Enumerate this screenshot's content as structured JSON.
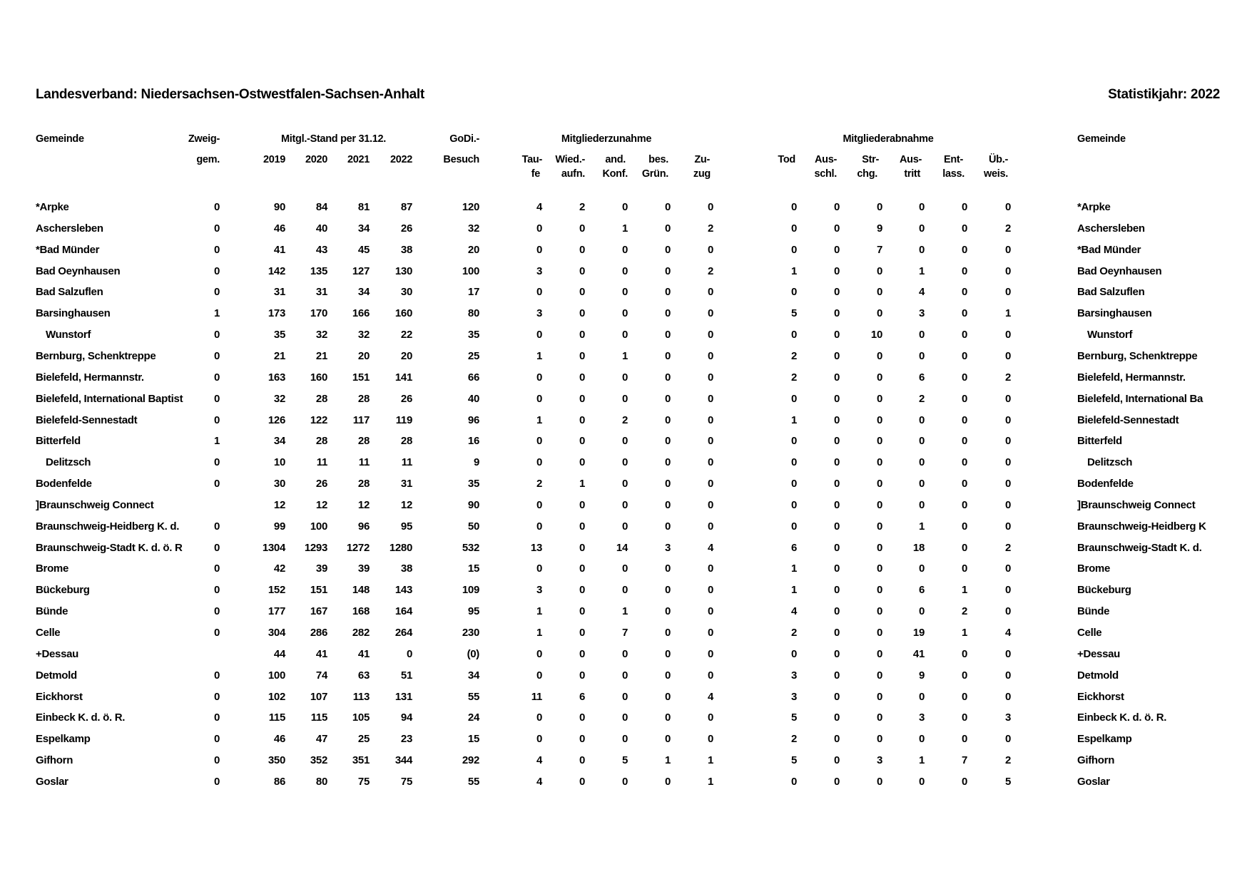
{
  "header": {
    "title_left": "Landesverband: Niedersachsen-Ostwestfalen-Sachsen-Anhalt",
    "title_right": "Statistikjahr: 2022"
  },
  "columns": {
    "gemeinde": "Gemeinde",
    "zweig_1": "Zweig-",
    "zweig_2": "gem.",
    "mitgl_group": "Mitgl.-Stand per 31.12.",
    "y2019": "2019",
    "y2020": "2020",
    "y2021": "2021",
    "y2022": "2022",
    "godi_1": "GoDi.-",
    "godi_2": "Besuch",
    "zunahme_group": "Mitgliederzunahme",
    "taufe_1": "Tau-",
    "taufe_2": "fe",
    "wied_1": "Wied.-",
    "wied_2": "aufn.",
    "and_1": "and.",
    "and_2": "Konf.",
    "bes_1": "bes.",
    "bes_2": "Grün.",
    "zuzug_1": "Zu-",
    "zuzug_2": "zug",
    "abnahme_group": "Mitgliederabnahme",
    "tod": "Tod",
    "aus_1": "Aus-",
    "aus_2": "schl.",
    "str_1": "Str-",
    "str_2": "chg.",
    "austritt_1": "Aus-",
    "austritt_2": "tritt",
    "ent_1": "Ent-",
    "ent_2": "lass.",
    "ub_1": "Üb.-",
    "ub_2": "weis.",
    "gemeinde_right": "Gemeinde"
  },
  "rows": [
    {
      "name": "*Arpke",
      "name_right": "*Arpke",
      "indent": false,
      "zweig": "0",
      "y2019": "90",
      "y2020": "84",
      "y2021": "81",
      "y2022": "87",
      "godi": "120",
      "taufe": "4",
      "wied": "2",
      "andkonf": "0",
      "bes": "0",
      "zuzug": "0",
      "tod": "0",
      "ausschl": "0",
      "strchg": "0",
      "austritt": "0",
      "entlass": "0",
      "ubweis": "0"
    },
    {
      "name": "Aschersleben",
      "name_right": "Aschersleben",
      "indent": false,
      "zweig": "0",
      "y2019": "46",
      "y2020": "40",
      "y2021": "34",
      "y2022": "26",
      "godi": "32",
      "taufe": "0",
      "wied": "0",
      "andkonf": "1",
      "bes": "0",
      "zuzug": "2",
      "tod": "0",
      "ausschl": "0",
      "strchg": "9",
      "austritt": "0",
      "entlass": "0",
      "ubweis": "2"
    },
    {
      "name": "*Bad Münder",
      "name_right": "*Bad Münder",
      "indent": false,
      "zweig": "0",
      "y2019": "41",
      "y2020": "43",
      "y2021": "45",
      "y2022": "38",
      "godi": "20",
      "taufe": "0",
      "wied": "0",
      "andkonf": "0",
      "bes": "0",
      "zuzug": "0",
      "tod": "0",
      "ausschl": "0",
      "strchg": "7",
      "austritt": "0",
      "entlass": "0",
      "ubweis": "0"
    },
    {
      "name": "Bad Oeynhausen",
      "name_right": "Bad Oeynhausen",
      "indent": false,
      "zweig": "0",
      "y2019": "142",
      "y2020": "135",
      "y2021": "127",
      "y2022": "130",
      "godi": "100",
      "taufe": "3",
      "wied": "0",
      "andkonf": "0",
      "bes": "0",
      "zuzug": "2",
      "tod": "1",
      "ausschl": "0",
      "strchg": "0",
      "austritt": "1",
      "entlass": "0",
      "ubweis": "0"
    },
    {
      "name": "Bad Salzuflen",
      "name_right": "Bad Salzuflen",
      "indent": false,
      "zweig": "0",
      "y2019": "31",
      "y2020": "31",
      "y2021": "34",
      "y2022": "30",
      "godi": "17",
      "taufe": "0",
      "wied": "0",
      "andkonf": "0",
      "bes": "0",
      "zuzug": "0",
      "tod": "0",
      "ausschl": "0",
      "strchg": "0",
      "austritt": "4",
      "entlass": "0",
      "ubweis": "0"
    },
    {
      "name": "Barsinghausen",
      "name_right": "Barsinghausen",
      "indent": false,
      "zweig": "1",
      "y2019": "173",
      "y2020": "170",
      "y2021": "166",
      "y2022": "160",
      "godi": "80",
      "taufe": "3",
      "wied": "0",
      "andkonf": "0",
      "bes": "0",
      "zuzug": "0",
      "tod": "5",
      "ausschl": "0",
      "strchg": "0",
      "austritt": "3",
      "entlass": "0",
      "ubweis": "1"
    },
    {
      "name": "Wunstorf",
      "name_right": "Wunstorf",
      "indent": true,
      "zweig": "0",
      "y2019": "35",
      "y2020": "32",
      "y2021": "32",
      "y2022": "22",
      "godi": "35",
      "taufe": "0",
      "wied": "0",
      "andkonf": "0",
      "bes": "0",
      "zuzug": "0",
      "tod": "0",
      "ausschl": "0",
      "strchg": "10",
      "austritt": "0",
      "entlass": "0",
      "ubweis": "0"
    },
    {
      "name": "Bernburg, Schenktreppe",
      "name_right": "Bernburg, Schenktreppe",
      "indent": false,
      "zweig": "0",
      "y2019": "21",
      "y2020": "21",
      "y2021": "20",
      "y2022": "20",
      "godi": "25",
      "taufe": "1",
      "wied": "0",
      "andkonf": "1",
      "bes": "0",
      "zuzug": "0",
      "tod": "2",
      "ausschl": "0",
      "strchg": "0",
      "austritt": "0",
      "entlass": "0",
      "ubweis": "0"
    },
    {
      "name": "Bielefeld, Hermannstr.",
      "name_right": "Bielefeld, Hermannstr.",
      "indent": false,
      "zweig": "0",
      "y2019": "163",
      "y2020": "160",
      "y2021": "151",
      "y2022": "141",
      "godi": "66",
      "taufe": "0",
      "wied": "0",
      "andkonf": "0",
      "bes": "0",
      "zuzug": "0",
      "tod": "2",
      "ausschl": "0",
      "strchg": "0",
      "austritt": "6",
      "entlass": "0",
      "ubweis": "2"
    },
    {
      "name": "Bielefeld, International Baptist",
      "name_right": "Bielefeld, International Ba",
      "indent": false,
      "zweig": "0",
      "y2019": "32",
      "y2020": "28",
      "y2021": "28",
      "y2022": "26",
      "godi": "40",
      "taufe": "0",
      "wied": "0",
      "andkonf": "0",
      "bes": "0",
      "zuzug": "0",
      "tod": "0",
      "ausschl": "0",
      "strchg": "0",
      "austritt": "2",
      "entlass": "0",
      "ubweis": "0"
    },
    {
      "name": "Bielefeld-Sennestadt",
      "name_right": "Bielefeld-Sennestadt",
      "indent": false,
      "zweig": "0",
      "y2019": "126",
      "y2020": "122",
      "y2021": "117",
      "y2022": "119",
      "godi": "96",
      "taufe": "1",
      "wied": "0",
      "andkonf": "2",
      "bes": "0",
      "zuzug": "0",
      "tod": "1",
      "ausschl": "0",
      "strchg": "0",
      "austritt": "0",
      "entlass": "0",
      "ubweis": "0"
    },
    {
      "name": "Bitterfeld",
      "name_right": "Bitterfeld",
      "indent": false,
      "zweig": "1",
      "y2019": "34",
      "y2020": "28",
      "y2021": "28",
      "y2022": "28",
      "godi": "16",
      "taufe": "0",
      "wied": "0",
      "andkonf": "0",
      "bes": "0",
      "zuzug": "0",
      "tod": "0",
      "ausschl": "0",
      "strchg": "0",
      "austritt": "0",
      "entlass": "0",
      "ubweis": "0"
    },
    {
      "name": "Delitzsch",
      "name_right": "Delitzsch",
      "indent": true,
      "zweig": "0",
      "y2019": "10",
      "y2020": "11",
      "y2021": "11",
      "y2022": "11",
      "godi": "9",
      "taufe": "0",
      "wied": "0",
      "andkonf": "0",
      "bes": "0",
      "zuzug": "0",
      "tod": "0",
      "ausschl": "0",
      "strchg": "0",
      "austritt": "0",
      "entlass": "0",
      "ubweis": "0"
    },
    {
      "name": "Bodenfelde",
      "name_right": "Bodenfelde",
      "indent": false,
      "zweig": "0",
      "y2019": "30",
      "y2020": "26",
      "y2021": "28",
      "y2022": "31",
      "godi": "35",
      "taufe": "2",
      "wied": "1",
      "andkonf": "0",
      "bes": "0",
      "zuzug": "0",
      "tod": "0",
      "ausschl": "0",
      "strchg": "0",
      "austritt": "0",
      "entlass": "0",
      "ubweis": "0"
    },
    {
      "name": "]Braunschweig Connect",
      "name_right": "]Braunschweig Connect",
      "indent": false,
      "zweig": "",
      "y2019": "12",
      "y2020": "12",
      "y2021": "12",
      "y2022": "12",
      "godi": "90",
      "taufe": "0",
      "wied": "0",
      "andkonf": "0",
      "bes": "0",
      "zuzug": "0",
      "tod": "0",
      "ausschl": "0",
      "strchg": "0",
      "austritt": "0",
      "entlass": "0",
      "ubweis": "0"
    },
    {
      "name": "Braunschweig-Heidberg K. d.",
      "name_right": "Braunschweig-Heidberg K",
      "indent": false,
      "zweig": "0",
      "y2019": "99",
      "y2020": "100",
      "y2021": "96",
      "y2022": "95",
      "godi": "50",
      "taufe": "0",
      "wied": "0",
      "andkonf": "0",
      "bes": "0",
      "zuzug": "0",
      "tod": "0",
      "ausschl": "0",
      "strchg": "0",
      "austritt": "1",
      "entlass": "0",
      "ubweis": "0"
    },
    {
      "name": "Braunschweig-Stadt K. d. ö. R",
      "name_right": "Braunschweig-Stadt K. d.",
      "indent": false,
      "zweig": "0",
      "y2019": "1304",
      "y2020": "1293",
      "y2021": "1272",
      "y2022": "1280",
      "godi": "532",
      "taufe": "13",
      "wied": "0",
      "andkonf": "14",
      "bes": "3",
      "zuzug": "4",
      "tod": "6",
      "ausschl": "0",
      "strchg": "0",
      "austritt": "18",
      "entlass": "0",
      "ubweis": "2"
    },
    {
      "name": "Brome",
      "name_right": "Brome",
      "indent": false,
      "zweig": "0",
      "y2019": "42",
      "y2020": "39",
      "y2021": "39",
      "y2022": "38",
      "godi": "15",
      "taufe": "0",
      "wied": "0",
      "andkonf": "0",
      "bes": "0",
      "zuzug": "0",
      "tod": "1",
      "ausschl": "0",
      "strchg": "0",
      "austritt": "0",
      "entlass": "0",
      "ubweis": "0"
    },
    {
      "name": "Bückeburg",
      "name_right": "Bückeburg",
      "indent": false,
      "zweig": "0",
      "y2019": "152",
      "y2020": "151",
      "y2021": "148",
      "y2022": "143",
      "godi": "109",
      "taufe": "3",
      "wied": "0",
      "andkonf": "0",
      "bes": "0",
      "zuzug": "0",
      "tod": "1",
      "ausschl": "0",
      "strchg": "0",
      "austritt": "6",
      "entlass": "1",
      "ubweis": "0"
    },
    {
      "name": "Bünde",
      "name_right": "Bünde",
      "indent": false,
      "zweig": "0",
      "y2019": "177",
      "y2020": "167",
      "y2021": "168",
      "y2022": "164",
      "godi": "95",
      "taufe": "1",
      "wied": "0",
      "andkonf": "1",
      "bes": "0",
      "zuzug": "0",
      "tod": "4",
      "ausschl": "0",
      "strchg": "0",
      "austritt": "0",
      "entlass": "2",
      "ubweis": "0"
    },
    {
      "name": "Celle",
      "name_right": "Celle",
      "indent": false,
      "zweig": "0",
      "y2019": "304",
      "y2020": "286",
      "y2021": "282",
      "y2022": "264",
      "godi": "230",
      "taufe": "1",
      "wied": "0",
      "andkonf": "7",
      "bes": "0",
      "zuzug": "0",
      "tod": "2",
      "ausschl": "0",
      "strchg": "0",
      "austritt": "19",
      "entlass": "1",
      "ubweis": "4"
    },
    {
      "name": "+Dessau",
      "name_right": "+Dessau",
      "indent": false,
      "zweig": "",
      "y2019": "44",
      "y2020": "41",
      "y2021": "41",
      "y2022": "0",
      "godi": "(0)",
      "taufe": "0",
      "wied": "0",
      "andkonf": "0",
      "bes": "0",
      "zuzug": "0",
      "tod": "0",
      "ausschl": "0",
      "strchg": "0",
      "austritt": "41",
      "entlass": "0",
      "ubweis": "0"
    },
    {
      "name": "Detmold",
      "name_right": "Detmold",
      "indent": false,
      "zweig": "0",
      "y2019": "100",
      "y2020": "74",
      "y2021": "63",
      "y2022": "51",
      "godi": "34",
      "taufe": "0",
      "wied": "0",
      "andkonf": "0",
      "bes": "0",
      "zuzug": "0",
      "tod": "3",
      "ausschl": "0",
      "strchg": "0",
      "austritt": "9",
      "entlass": "0",
      "ubweis": "0"
    },
    {
      "name": "Eickhorst",
      "name_right": "Eickhorst",
      "indent": false,
      "zweig": "0",
      "y2019": "102",
      "y2020": "107",
      "y2021": "113",
      "y2022": "131",
      "godi": "55",
      "taufe": "11",
      "wied": "6",
      "andkonf": "0",
      "bes": "0",
      "zuzug": "4",
      "tod": "3",
      "ausschl": "0",
      "strchg": "0",
      "austritt": "0",
      "entlass": "0",
      "ubweis": "0"
    },
    {
      "name": "Einbeck K. d. ö. R.",
      "name_right": "Einbeck K. d. ö. R.",
      "indent": false,
      "zweig": "0",
      "y2019": "115",
      "y2020": "115",
      "y2021": "105",
      "y2022": "94",
      "godi": "24",
      "taufe": "0",
      "wied": "0",
      "andkonf": "0",
      "bes": "0",
      "zuzug": "0",
      "tod": "5",
      "ausschl": "0",
      "strchg": "0",
      "austritt": "3",
      "entlass": "0",
      "ubweis": "3"
    },
    {
      "name": "Espelkamp",
      "name_right": "Espelkamp",
      "indent": false,
      "zweig": "0",
      "y2019": "46",
      "y2020": "47",
      "y2021": "25",
      "y2022": "23",
      "godi": "15",
      "taufe": "0",
      "wied": "0",
      "andkonf": "0",
      "bes": "0",
      "zuzug": "0",
      "tod": "2",
      "ausschl": "0",
      "strchg": "0",
      "austritt": "0",
      "entlass": "0",
      "ubweis": "0"
    },
    {
      "name": "Gifhorn",
      "name_right": "Gifhorn",
      "indent": false,
      "zweig": "0",
      "y2019": "350",
      "y2020": "352",
      "y2021": "351",
      "y2022": "344",
      "godi": "292",
      "taufe": "4",
      "wied": "0",
      "andkonf": "5",
      "bes": "1",
      "zuzug": "1",
      "tod": "5",
      "ausschl": "0",
      "strchg": "3",
      "austritt": "1",
      "entlass": "7",
      "ubweis": "2"
    },
    {
      "name": "Goslar",
      "name_right": "Goslar",
      "indent": false,
      "zweig": "0",
      "y2019": "86",
      "y2020": "80",
      "y2021": "75",
      "y2022": "75",
      "godi": "55",
      "taufe": "4",
      "wied": "0",
      "andkonf": "0",
      "bes": "0",
      "zuzug": "1",
      "tod": "0",
      "ausschl": "0",
      "strchg": "0",
      "austritt": "0",
      "entlass": "0",
      "ubweis": "5"
    }
  ]
}
